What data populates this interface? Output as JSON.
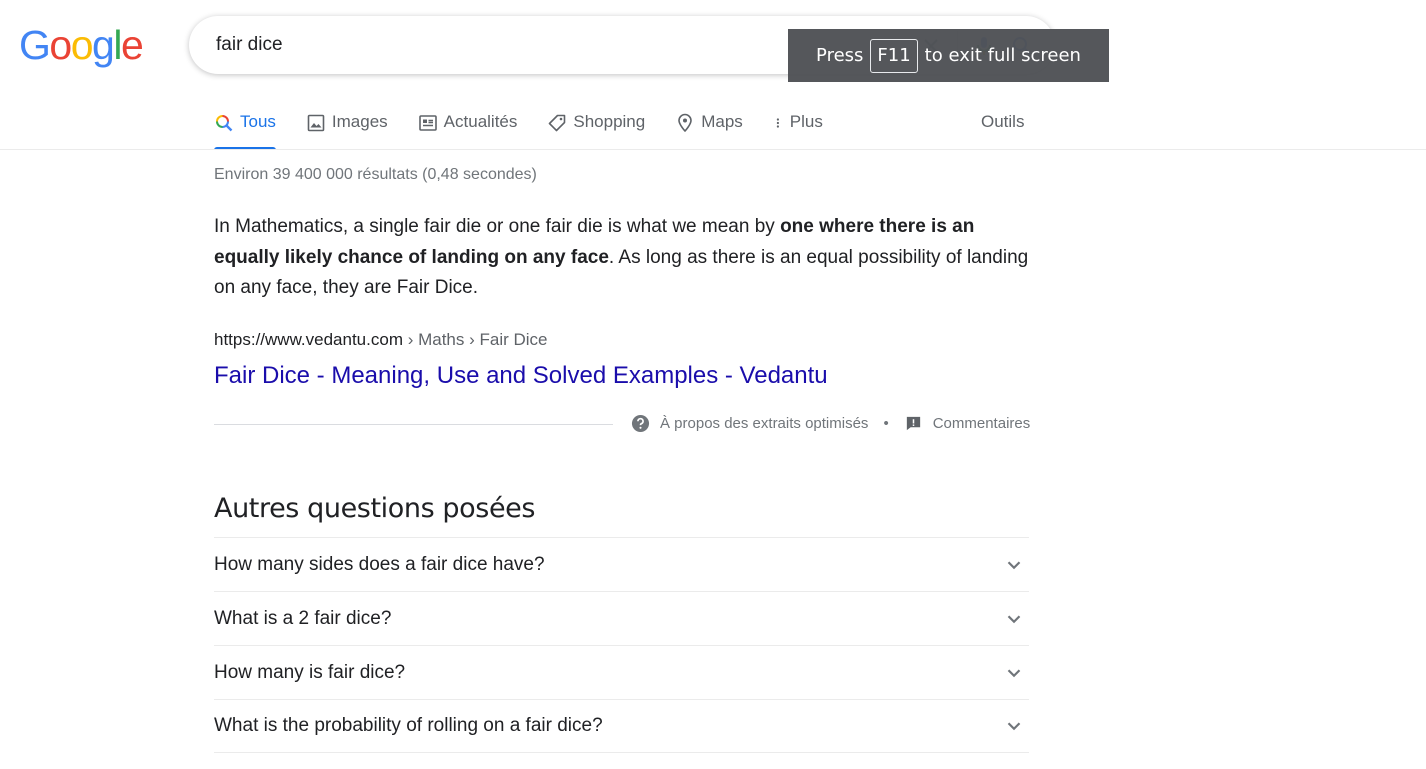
{
  "logo": {
    "letters": [
      {
        "ch": "G",
        "color": "#4285F4"
      },
      {
        "ch": "o",
        "color": "#EA4335"
      },
      {
        "ch": "o",
        "color": "#FBBC05"
      },
      {
        "ch": "g",
        "color": "#4285F4"
      },
      {
        "ch": "l",
        "color": "#34A853"
      },
      {
        "ch": "e",
        "color": "#EA4335"
      }
    ]
  },
  "search": {
    "value": "fair dice"
  },
  "fullscreen": {
    "press": "Press",
    "key": "F11",
    "suffix": "to exit full screen"
  },
  "tabs": [
    {
      "label": "Tous",
      "icon": "search-icon",
      "active": true
    },
    {
      "label": "Images",
      "icon": "image-icon"
    },
    {
      "label": "Actualités",
      "icon": "news-icon"
    },
    {
      "label": "Shopping",
      "icon": "tag-icon"
    },
    {
      "label": "Maps",
      "icon": "map-pin-icon"
    },
    {
      "label": "Plus",
      "icon": "more-vert-icon"
    }
  ],
  "tools_label": "Outils",
  "stats": "Environ 39 400 000 résultats (0,48 secondes)",
  "snippet": {
    "part1": "In Mathematics, a single fair die or one fair die is what we mean by ",
    "bold": "one where there is an equally likely chance of landing on any face",
    "part2": ". As long as there is an equal possibility of landing on any face, they are Fair Dice."
  },
  "result": {
    "url": "https://www.vedantu.com",
    "path": " › Maths › Fair Dice",
    "title": "Fair Dice - Meaning, Use and Solved Examples - Vedantu"
  },
  "feedback": {
    "about": "À propos des extraits optimisés",
    "separator": "•",
    "comments": "Commentaires"
  },
  "paa": {
    "title": "Autres questions posées",
    "questions": [
      "How many sides does a fair dice have?",
      "What is a 2 fair dice?",
      "How many is fair dice?",
      "What is the probability of rolling on a fair dice?"
    ]
  },
  "colors": {
    "link": "#1a0dab",
    "accent": "#1a73e8",
    "muted": "#70757a"
  }
}
